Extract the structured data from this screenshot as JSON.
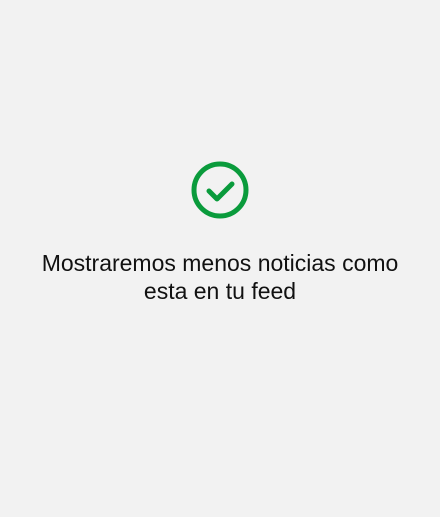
{
  "confirmation": {
    "icon": "check-circle-icon",
    "icon_color": "#0a9b3c",
    "message": "Mostraremos menos noticias como esta en tu feed"
  },
  "colors": {
    "background": "#f2f2f2",
    "text": "#111111"
  }
}
